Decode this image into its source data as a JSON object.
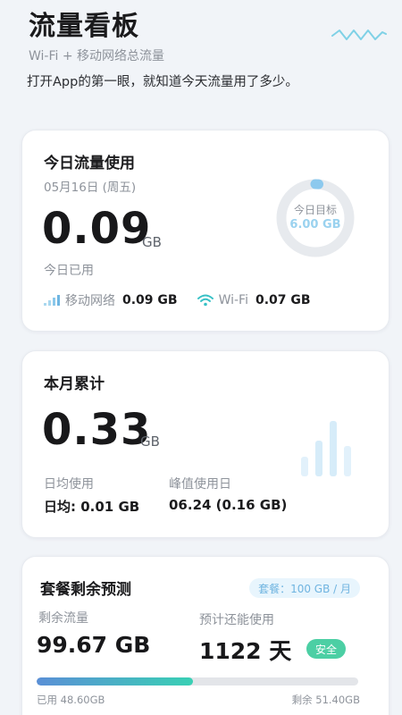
{
  "header": {
    "title": "流量看板",
    "subtitle": "Wi-Fi + 移动网络总流量",
    "tagline": "打开App的第一眼，就知道今天流量用了多少。"
  },
  "today": {
    "title": "今日流量使用",
    "date": "05月16日 (周五)",
    "value": "0.09",
    "unit": "GB",
    "used_label": "今日已用",
    "mobile_label": "移动网络",
    "mobile_value": "0.09 GB",
    "wifi_label": "Wi-Fi",
    "wifi_value": "0.07 GB",
    "goal_label": "今日目标",
    "goal_value": "6.00 GB",
    "goal_progress": 0.015
  },
  "month": {
    "title": "本月累计",
    "value": "0.33",
    "unit": "GB",
    "avg_label": "日均使用",
    "avg_value": "日均: 0.01 GB",
    "peak_label": "峰值使用日",
    "peak_value": "06.24 (0.16 GB)"
  },
  "plan": {
    "title": "套餐剩余预测",
    "badge": "套餐：100 GB / 月",
    "remain_label": "剩余流量",
    "remain_value": "99.67 GB",
    "days_label": "预计还能使用",
    "days_value": "1122 天",
    "safe_badge": "安全",
    "used_text": "已用 48.60GB",
    "remain_text": "剩余 51.40GB",
    "used_fraction": 0.486
  },
  "colors": {
    "accent_blue": "#5a8fd6",
    "accent_green": "#39d0b4",
    "safe": "#4ccfa4",
    "ring_track": "#e7eaee"
  }
}
